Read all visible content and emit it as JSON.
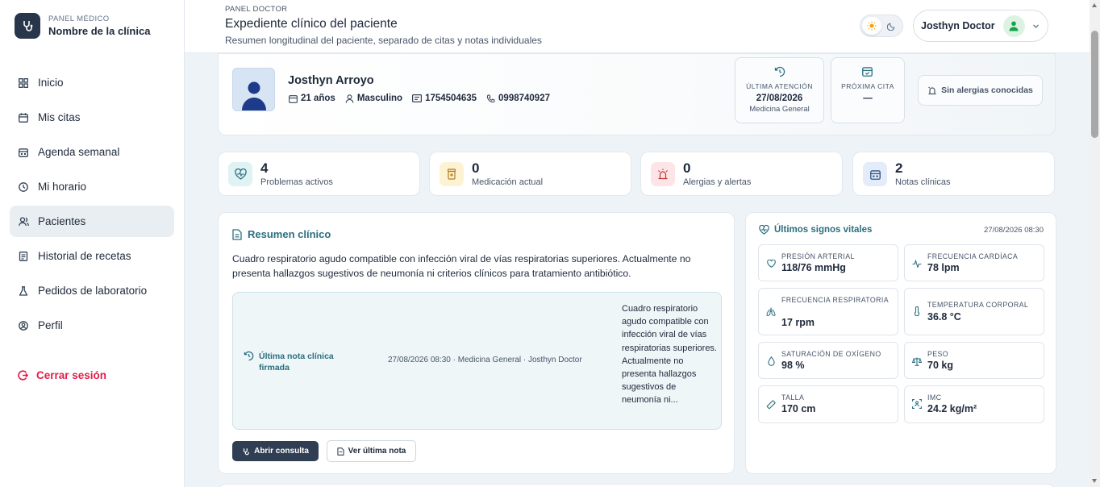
{
  "sidebar": {
    "kicker": "PANEL MÉDICO",
    "clinic_name": "Nombre de la clínica",
    "items": [
      {
        "label": "Inicio",
        "icon": "grid-icon"
      },
      {
        "label": "Mis citas",
        "icon": "calendar-icon"
      },
      {
        "label": "Agenda semanal",
        "icon": "calendar-week-icon"
      },
      {
        "label": "Mi horario",
        "icon": "clock-icon"
      },
      {
        "label": "Pacientes",
        "icon": "users-icon",
        "active": true
      },
      {
        "label": "Historial de recetas",
        "icon": "prescription-icon"
      },
      {
        "label": "Pedidos de laboratorio",
        "icon": "flask-icon"
      },
      {
        "label": "Perfil",
        "icon": "user-circle-icon"
      }
    ],
    "logout": "Cerrar sesión"
  },
  "header": {
    "kicker": "PANEL DOCTOR",
    "title": "Expediente clínico del paciente",
    "subtitle": "Resumen longitudinal del paciente, separado de citas y notas individuales",
    "user_name": "Josthyn Doctor"
  },
  "patient": {
    "name": "Josthyn Arroyo",
    "age": "21 años",
    "sex": "Masculino",
    "id_number": "1754504635",
    "phone": "0998740927",
    "last_visit": {
      "label": "ÚLTIMA ATENCIÓN",
      "date": "27/08/2026",
      "specialty": "Medicina General"
    },
    "next_appointment": {
      "label": "PRÓXIMA CITA",
      "value": "—"
    },
    "allergies_button": "Sin alergias conocidas"
  },
  "stats": [
    {
      "value": "4",
      "label": "Problemas activos",
      "icon": "heart-pulse-icon"
    },
    {
      "value": "0",
      "label": "Medicación actual",
      "icon": "pill-bottle-icon"
    },
    {
      "value": "0",
      "label": "Alergias y alertas",
      "icon": "alert-siren-icon"
    },
    {
      "value": "2",
      "label": "Notas clínicas",
      "icon": "calendar-notes-icon"
    }
  ],
  "summary": {
    "title": "Resumen clínico",
    "text": "Cuadro respiratorio agudo compatible con infección viral de vías respiratorias superiores. Actualmente no presenta hallazgos sugestivos de neumonía ni criterios clínicos para tratamiento antibiótico.",
    "last_note": {
      "label": "Última nota clínica firmada",
      "meta": "27/08/2026 08:30 · Medicina General · Josthyn Doctor",
      "excerpt": "Cuadro respiratorio agudo compatible con infección viral de vías respiratorias superiores. Actualmente no presenta hallazgos sugestivos de neumonía ni..."
    },
    "open_button": "Abrir consulta",
    "view_button": "Ver última nota"
  },
  "vitals": {
    "title": "Últimos signos vitales",
    "date": "27/08/2026 08:30",
    "items": [
      {
        "label": "PRESIÓN ARTERIAL",
        "value": "118/76 mmHg",
        "icon": "heart-icon"
      },
      {
        "label": "FRECUENCIA CARDÍACA",
        "value": "78 lpm",
        "icon": "activity-icon"
      },
      {
        "label": "FRECUENCIA RESPIRATORIA",
        "value": "17 rpm",
        "icon": "lungs-icon"
      },
      {
        "label": "TEMPERATURA CORPORAL",
        "value": "36.8 °C",
        "icon": "thermometer-icon"
      },
      {
        "label": "SATURACIÓN DE OXÍGENO",
        "value": "98 %",
        "icon": "droplet-icon"
      },
      {
        "label": "PESO",
        "value": "70 kg",
        "icon": "scale-icon"
      },
      {
        "label": "TALLA",
        "value": "170 cm",
        "icon": "ruler-icon"
      },
      {
        "label": "IMC",
        "value": "24.2 kg/m²",
        "icon": "body-scan-icon"
      }
    ]
  }
}
